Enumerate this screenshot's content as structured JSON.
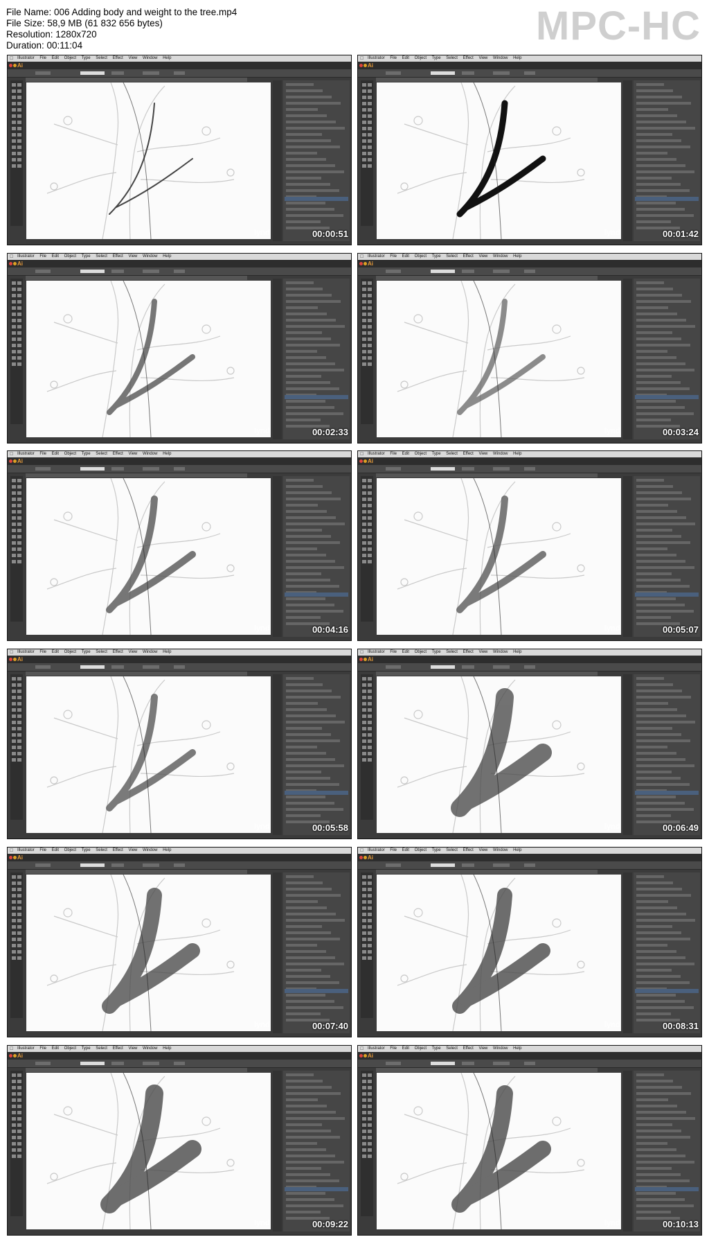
{
  "file_info": {
    "name": "File Name: 006 Adding body and weight to the tree.mp4",
    "size": "File Size: 58,9 MB (61 832 656 bytes)",
    "resolution": "Resolution: 1280x720",
    "duration": "Duration: 00:11:04"
  },
  "player_brand": "MPC-HC",
  "app": {
    "menubar": "Illustrator File Edit Object Type Select Effect View Window Help",
    "logo": "Ai"
  },
  "watermark": "lynd",
  "frames": [
    {
      "timestamp": "00:00:51"
    },
    {
      "timestamp": "00:01:42"
    },
    {
      "timestamp": "00:02:33"
    },
    {
      "timestamp": "00:03:24"
    },
    {
      "timestamp": "00:04:16"
    },
    {
      "timestamp": "00:05:07"
    },
    {
      "timestamp": "00:05:58"
    },
    {
      "timestamp": "00:06:49"
    },
    {
      "timestamp": "00:07:40"
    },
    {
      "timestamp": "00:08:31"
    },
    {
      "timestamp": "00:09:22"
    },
    {
      "timestamp": "00:10:13"
    }
  ]
}
